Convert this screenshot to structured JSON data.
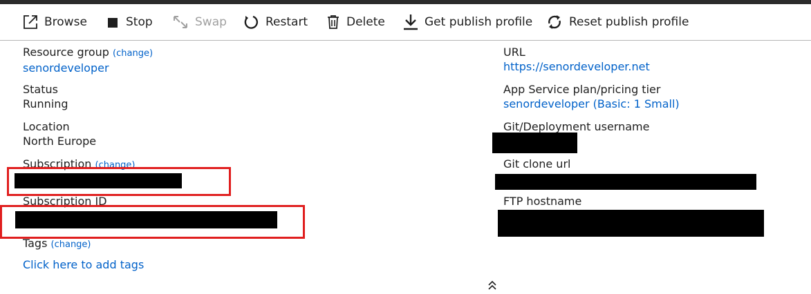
{
  "toolbar": {
    "browse": "Browse",
    "stop": "Stop",
    "swap": "Swap",
    "restart": "Restart",
    "delete": "Delete",
    "get_publish_profile": "Get publish profile",
    "reset_publish_profile": "Reset publish profile"
  },
  "left": {
    "resource_group_label": "Resource group",
    "resource_group_change": "(change)",
    "resource_group_value": "senordeveloper",
    "status_label": "Status",
    "status_value": "Running",
    "location_label": "Location",
    "location_value": "North Europe",
    "subscription_label": "Subscription",
    "subscription_change": "(change)",
    "subscription_id_label": "Subscription ID",
    "tags_label": "Tags",
    "tags_change": "(change)",
    "tags_add": "Click here to add tags"
  },
  "right": {
    "url_label": "URL",
    "url_value": "https://senordeveloper.net",
    "plan_label": "App Service plan/pricing tier",
    "plan_value": "senordeveloper (Basic: 1 Small)",
    "git_user_label": "Git/Deployment username",
    "git_clone_label": "Git clone url",
    "ftp_label": "FTP hostname"
  },
  "colors": {
    "link": "#0061c9",
    "highlight": "#e01e1e",
    "redaction": "#000000"
  }
}
